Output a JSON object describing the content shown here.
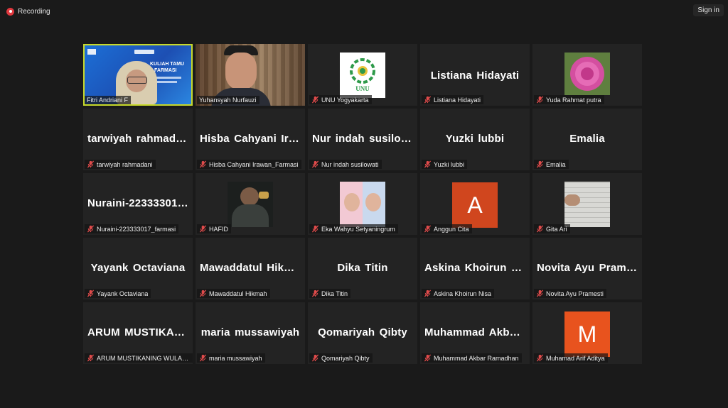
{
  "recording": {
    "label": "Recording"
  },
  "sign_in": {
    "label": "Sign in"
  },
  "participants": [
    {
      "display": "",
      "label": "Fitri Andriani F"
    },
    {
      "display": "",
      "label": "Yuhansyah Nurfauzi"
    },
    {
      "display": "",
      "label": "UNU Yogyakarta"
    },
    {
      "display": "Listiana Hidayati",
      "label": "Listiana Hidayati"
    },
    {
      "display": "",
      "label": "Yuda Rahmat putra"
    },
    {
      "display": "tarwiyah  rahmadani",
      "label": "tarwiyah rahmadani"
    },
    {
      "display": "Hisba Cahyani Irawan_Farmasi",
      "label": "Hisba Cahyani Irawan_Farmasi"
    },
    {
      "display": "Nur indah susilowati",
      "label": "Nur indah susilowati"
    },
    {
      "display": "Yuzki lubbi",
      "label": "Yuzki lubbi"
    },
    {
      "display": "Emalia",
      "label": "Emalia"
    },
    {
      "display": "Nuraini-223333017_farmasi",
      "label": "Nuraini-223333017_farmasi"
    },
    {
      "display": "",
      "label": "HAFID"
    },
    {
      "display": "",
      "label": "Eka Wahyu Setyaningrum"
    },
    {
      "display": "",
      "label": "Anggun Cita",
      "avatar_letter": "A",
      "avatar_color": "#d0461e"
    },
    {
      "display": "",
      "label": "Gita Ari"
    },
    {
      "display": "Yayank Octaviana",
      "label": "Yayank Octaviana"
    },
    {
      "display": "Mawaddatul  Hikmah",
      "label": "Mawaddatul Hikmah"
    },
    {
      "display": "Dika Titin",
      "label": "Dika Titin"
    },
    {
      "display": "Askina  Khoirun  Nisa",
      "label": "Askina Khoirun Nisa"
    },
    {
      "display": "Novita  Ayu  Pramesti",
      "label": "Novita Ayu Pramesti"
    },
    {
      "display": "ARUM  MUSTIKANING WULANDARI",
      "label": "ARUM MUSTIKANING WULANDARI"
    },
    {
      "display": "maria  mussawiyah",
      "label": "maria mussawiyah"
    },
    {
      "display": "Qomariyah Qibty",
      "label": "Qomariyah Qibty"
    },
    {
      "display": "Muhammad  Akbar Ramadhan",
      "label": "Muhammad Akbar Ramadhan"
    },
    {
      "display": "",
      "label": "Muhamad Arif Aditya",
      "avatar_letter": "M",
      "avatar_color": "#e8531e"
    }
  ],
  "slide": {
    "title_line1": "KULIAH TAMU",
    "title_line2": "FARMASI"
  },
  "unu_logo": {
    "text": "UNU"
  },
  "colors": {
    "active_border": "#c8d92a",
    "mic_muted": "#e04b4b"
  }
}
